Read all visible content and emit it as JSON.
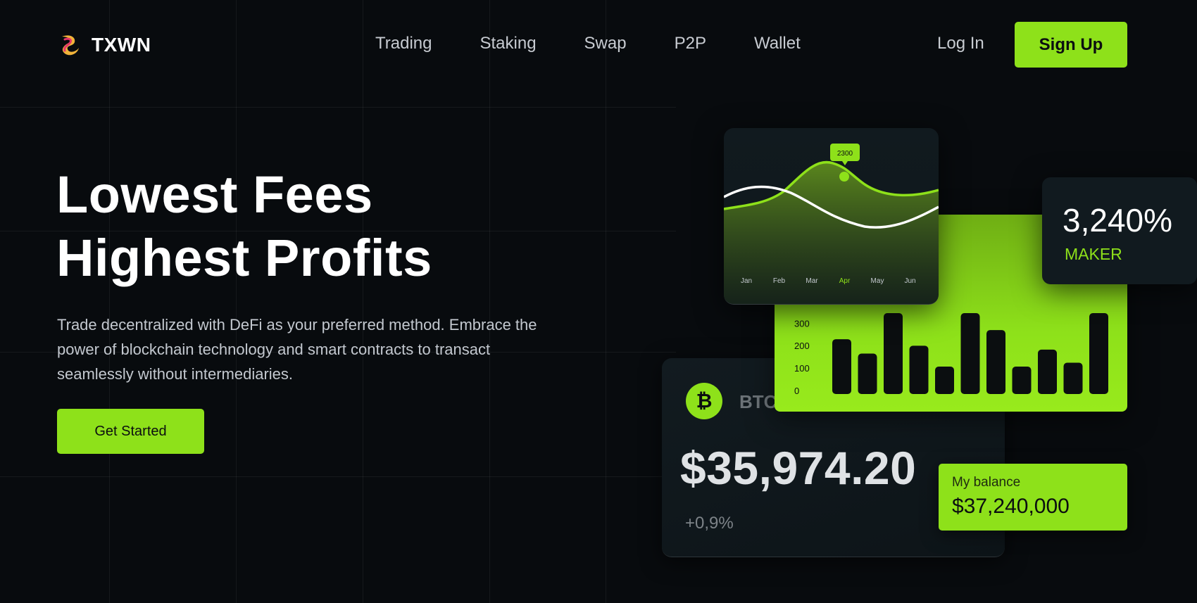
{
  "brand": {
    "name": "TXWN",
    "accent": "#8ee11a",
    "background": "#080b0e"
  },
  "nav": {
    "items": [
      {
        "label": "Trading"
      },
      {
        "label": "Staking"
      },
      {
        "label": "Swap"
      },
      {
        "label": "P2P"
      },
      {
        "label": "Wallet"
      }
    ],
    "login_label": "Log In",
    "signup_label": "Sign Up"
  },
  "hero": {
    "title_line1": "Lowest Fees",
    "title_line2": "Highest Profits",
    "description": "Trade decentralized with DeFi as your preferred method. Embrace the power of blockchain technology and smart contracts to transact seamlessly without intermediaries.",
    "cta_label": "Get Started"
  },
  "btc_card": {
    "icon": "bitcoin-icon",
    "symbol": "BTC",
    "price": "$35,974.20",
    "change": "+0,9%"
  },
  "line_chart": {
    "months": [
      "Jan",
      "Feb",
      "Mar",
      "Apr",
      "May",
      "Jun"
    ],
    "highlight_month": "Apr",
    "tooltip": "2300"
  },
  "bar_chart": {
    "y_ticks": [
      "0",
      "100",
      "200",
      "300"
    ],
    "values": [
      210,
      155,
      310,
      185,
      105,
      310,
      245,
      105,
      170,
      120,
      310
    ]
  },
  "maker_card": {
    "value": "3,240%",
    "label": "MAKER"
  },
  "balance_card": {
    "label": "My balance",
    "value": "$37,240,000"
  }
}
